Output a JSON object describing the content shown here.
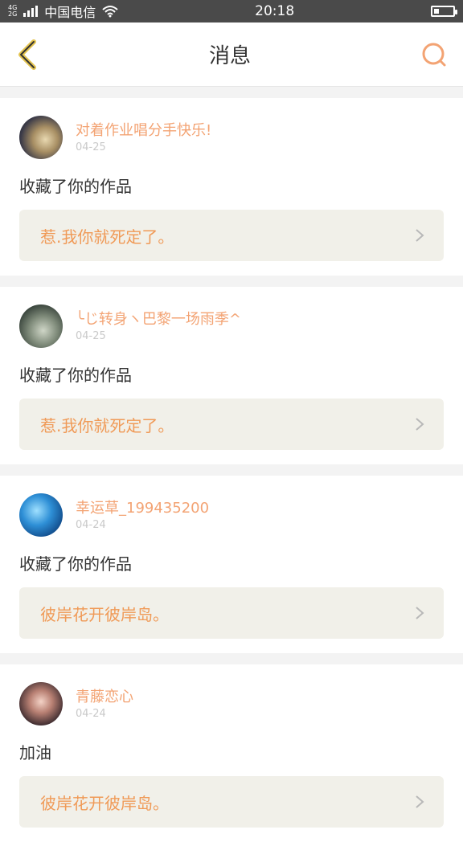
{
  "status_bar": {
    "network_top": "4G",
    "network_bottom": "2G",
    "carrier": "中国电信",
    "time": "20:18"
  },
  "header": {
    "title": "消息"
  },
  "messages": [
    {
      "username": "对着作业唱分手快乐!",
      "date": "04-25",
      "action": "收藏了你的作品",
      "work_title": "惹.我你就死定了。"
    },
    {
      "username": "╰じ转身ヽ巴黎一场雨季^",
      "date": "04-25",
      "action": "收藏了你的作品",
      "work_title": "惹.我你就死定了。"
    },
    {
      "username": "幸运草_199435200",
      "date": "04-24",
      "action": "收藏了你的作品",
      "work_title": "彼岸花开彼岸岛。"
    },
    {
      "username": "青藤恋心",
      "date": "04-24",
      "action": "加油",
      "work_title": "彼岸花开彼岸岛。"
    }
  ]
}
